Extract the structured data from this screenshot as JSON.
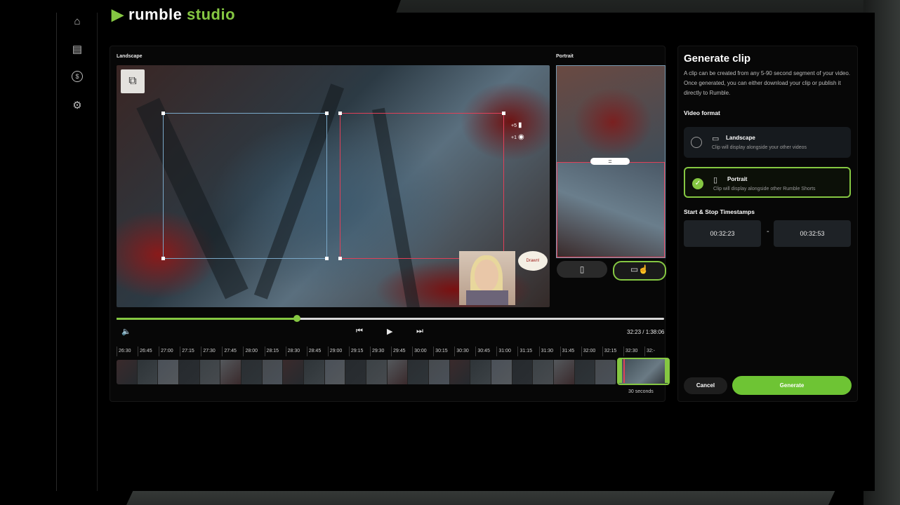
{
  "app": {
    "logo_text": "rumble",
    "logo_suffix": "studio"
  },
  "sidebar": {
    "items": [
      {
        "icon": "home-icon",
        "glyph": "⌂"
      },
      {
        "icon": "book-icon",
        "glyph": "▤"
      },
      {
        "icon": "dollar-icon",
        "glyph": "$"
      },
      {
        "icon": "gear-icon",
        "glyph": "⚙"
      }
    ]
  },
  "editor": {
    "landscape_label": "Landscape",
    "portrait_label": "Portrait",
    "zoom_plus": "+5",
    "zoom_minus": "+1",
    "webcam_sticker": "Drawn!",
    "playhead_fraction": 0.329,
    "time_display": "32:23 / 1:38:06",
    "selection_duration": "30 seconds",
    "timeline_ticks": [
      "26:30",
      "26:45",
      "27:00",
      "27:15",
      "27:30",
      "27:45",
      "28:00",
      "28:15",
      "28:30",
      "28:45",
      "29:00",
      "29:15",
      "29:30",
      "29:45",
      "30:00",
      "30:15",
      "30:30",
      "30:45",
      "31:00",
      "31:15",
      "31:30",
      "31:45",
      "32:00",
      "32:15",
      "32:30",
      "32:-"
    ]
  },
  "generate": {
    "title": "Generate clip",
    "description": "A clip can be created from any 5-90 second segment of your video. Once generated, you can either download your clip or publish it directly to Rumble.",
    "video_format_label": "Video format",
    "options": [
      {
        "title": "Landscape",
        "subtitle": "Clip will display alongside your other videos",
        "selected": false
      },
      {
        "title": "Portrait",
        "subtitle": "Clip will display alongside other Rumble Shorts",
        "selected": true
      }
    ],
    "timestamps_label": "Start & Stop Timestamps",
    "start_time": "00:32:23",
    "stop_time": "00:32:53",
    "cancel_label": "Cancel",
    "generate_label": "Generate"
  },
  "colors": {
    "accent": "#85c742",
    "crop_red": "#e04058",
    "crop_blue": "#7aa8c8"
  }
}
